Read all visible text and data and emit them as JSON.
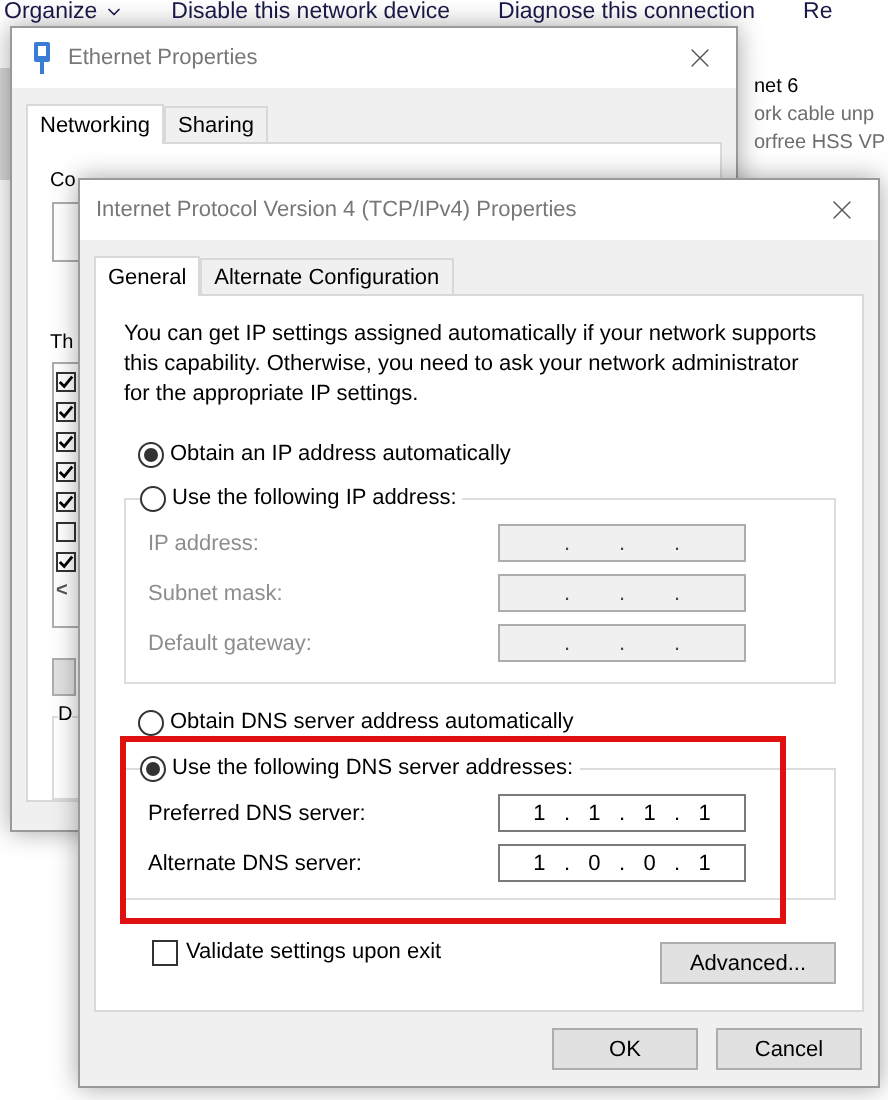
{
  "explorer": {
    "toolbar": [
      {
        "label": "Organize",
        "dropdown": true
      },
      {
        "label": "Disable this network device",
        "dropdown": false
      },
      {
        "label": "Diagnose this connection",
        "dropdown": false
      },
      {
        "label": "Re",
        "dropdown": false
      }
    ],
    "connection_lines": [
      "net 6",
      "ork cable unp",
      "orfree HSS VP"
    ]
  },
  "ethernet_window": {
    "title": "Ethernet Properties",
    "tabs": [
      {
        "label": "Networking",
        "selected": true
      },
      {
        "label": "Sharing",
        "selected": false
      }
    ],
    "connect_label": "Co",
    "list_label": "Th",
    "components": [
      {
        "checked": true
      },
      {
        "checked": true
      },
      {
        "checked": true
      },
      {
        "checked": true
      },
      {
        "checked": true
      },
      {
        "checked": false
      },
      {
        "checked": true
      }
    ],
    "scroll_left": "<",
    "group_label": "D"
  },
  "ipv4_window": {
    "title": "Internet Protocol Version 4 (TCP/IPv4) Properties",
    "tabs": [
      {
        "label": "General",
        "selected": true
      },
      {
        "label": "Alternate Configuration",
        "selected": false
      }
    ],
    "description": "You can get IP settings assigned automatically if your network supports this capability. Otherwise, you need to ask your network administrator for the appropriate IP settings.",
    "ip_auto": {
      "label": "Obtain an IP address automatically",
      "selected": true
    },
    "ip_manual": {
      "label": "Use the following IP address:",
      "selected": false
    },
    "ip_fields": [
      {
        "label": "IP address:",
        "value": ".        .        .",
        "disabled": true
      },
      {
        "label": "Subnet mask:",
        "value": ".        .        .",
        "disabled": true
      },
      {
        "label": "Default gateway:",
        "value": ".        .        .",
        "disabled": true
      }
    ],
    "dns_auto": {
      "label": "Obtain DNS server address automatically",
      "selected": false
    },
    "dns_manual": {
      "label": "Use the following DNS server addresses:",
      "selected": true
    },
    "dns_fields": [
      {
        "label": "Preferred DNS server:",
        "value": "1   .   1   .   1   .   1",
        "disabled": false
      },
      {
        "label": "Alternate DNS server:",
        "value": "1   .   0   .   0   .   1",
        "disabled": false
      }
    ],
    "highlight_dns": true,
    "validate": {
      "label": "Validate settings upon exit",
      "checked": false
    },
    "advanced_button": "Advanced...",
    "buttons": [
      "OK",
      "Cancel"
    ]
  }
}
